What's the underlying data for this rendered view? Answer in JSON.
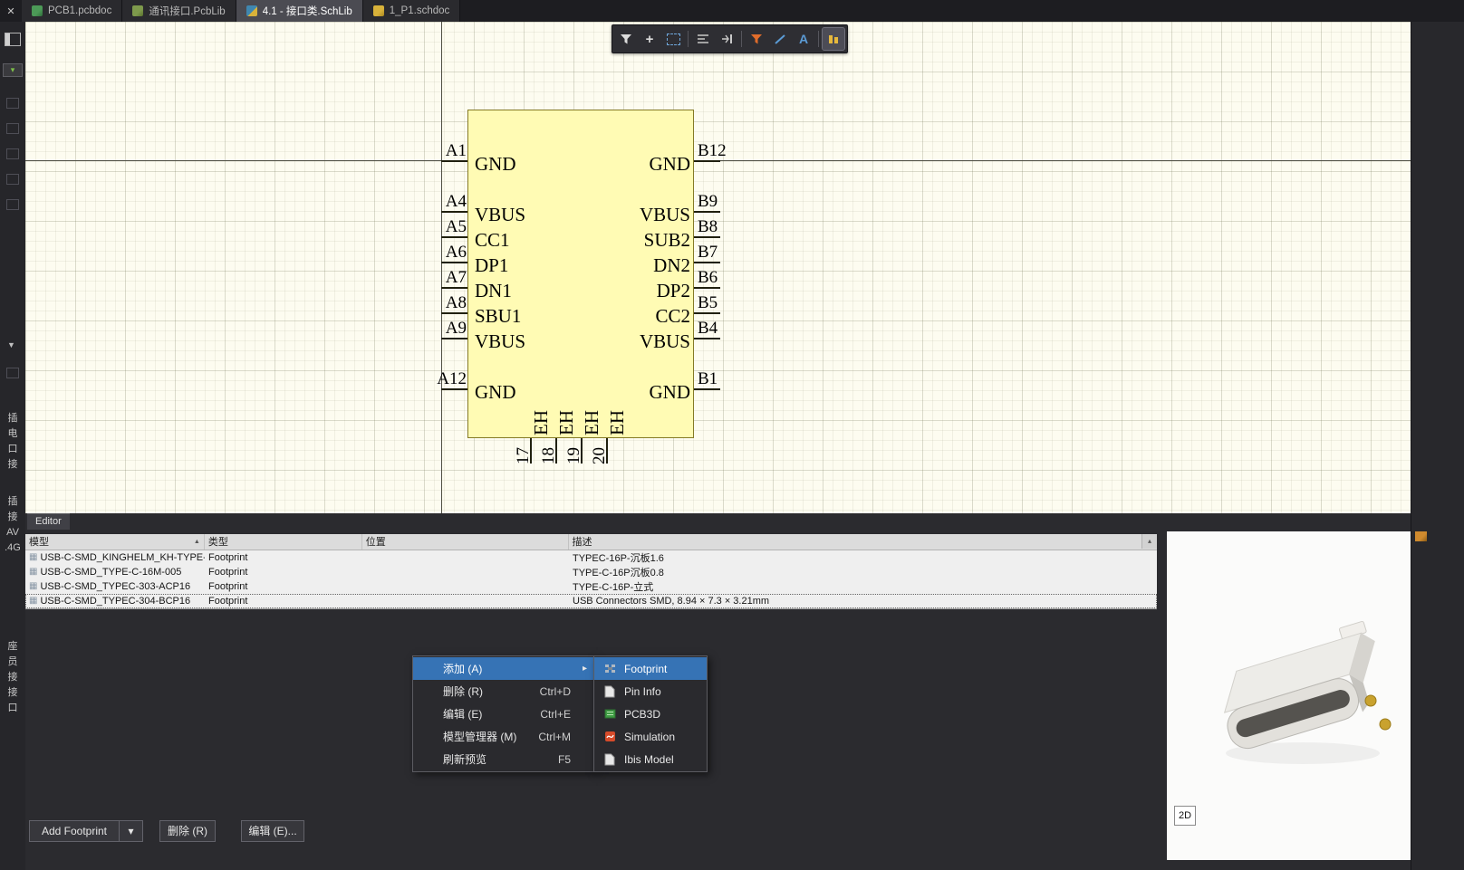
{
  "tabbar": {
    "close_glyph": "✕",
    "tabs": [
      {
        "label": "PCB1.pcbdoc"
      },
      {
        "label": "通讯接口.PcbLib"
      },
      {
        "label": "4.1 - 接口类.SchLib"
      },
      {
        "label": "1_P1.schdoc"
      }
    ]
  },
  "sidebar": {
    "group1": "插\n电\n口\n接",
    "group2": "插\n接\nAV\n.4G",
    "group3": "座\n员\n接\n接\n口"
  },
  "schematic": {
    "left_pins": [
      {
        "designator": "A1",
        "name": "GND"
      },
      {
        "designator": "A4",
        "name": "VBUS"
      },
      {
        "designator": "A5",
        "name": "CC1"
      },
      {
        "designator": "A6",
        "name": "DP1"
      },
      {
        "designator": "A7",
        "name": "DN1"
      },
      {
        "designator": "A8",
        "name": "SBU1"
      },
      {
        "designator": "A9",
        "name": "VBUS"
      },
      {
        "designator": "A12",
        "name": "GND"
      }
    ],
    "right_pins": [
      {
        "designator": "B12",
        "name": "GND"
      },
      {
        "designator": "B9",
        "name": "VBUS"
      },
      {
        "designator": "B8",
        "name": "SUB2"
      },
      {
        "designator": "B7",
        "name": "DN2"
      },
      {
        "designator": "B6",
        "name": "DP2"
      },
      {
        "designator": "B5",
        "name": "CC2"
      },
      {
        "designator": "B4",
        "name": "VBUS"
      },
      {
        "designator": "B1",
        "name": "GND"
      }
    ],
    "bottom_pins": [
      {
        "designator": "17",
        "name": "EH"
      },
      {
        "designator": "18",
        "name": "EH"
      },
      {
        "designator": "19",
        "name": "EH"
      },
      {
        "designator": "20",
        "name": "EH"
      }
    ]
  },
  "editor": {
    "tab_label": "Editor",
    "columns": {
      "model": "模型",
      "type": "类型",
      "location": "位置",
      "description": "描述"
    },
    "rows": [
      {
        "model": "USB-C-SMD_KINGHELM_KH-TYPE-C-\\",
        "type": "Footprint",
        "location": "",
        "description": "TYPEC-16P-沉板1.6"
      },
      {
        "model": "USB-C-SMD_TYPE-C-16M-005",
        "type": "Footprint",
        "location": "",
        "description": "TYPE-C-16P沉板0.8"
      },
      {
        "model": "USB-C-SMD_TYPEC-303-ACP16",
        "type": "Footprint",
        "location": "",
        "description": "TYPE-C-16P-立式"
      },
      {
        "model": "USB-C-SMD_TYPEC-304-BCP16",
        "type": "Footprint",
        "location": "",
        "description": "USB Connectors SMD, 8.94 × 7.3 × 3.21mm"
      }
    ],
    "buttons": {
      "add": "Add Footprint",
      "dropdown_glyph": "▾",
      "delete": "删除 (R)",
      "edit": "编辑 (E)..."
    }
  },
  "context_menu": {
    "items": [
      {
        "label": "添加 (A)",
        "shortcut": ""
      },
      {
        "label": "删除 (R)",
        "shortcut": "Ctrl+D"
      },
      {
        "label": "编辑 (E)",
        "shortcut": "Ctrl+E"
      },
      {
        "label": "模型管理器 (M)",
        "shortcut": "Ctrl+M"
      },
      {
        "label": "刷新预览",
        "shortcut": "F5"
      }
    ],
    "submenu_arrow_glyph": "▸",
    "submenu": [
      {
        "label": "Footprint"
      },
      {
        "label": "Pin Info"
      },
      {
        "label": "PCB3D"
      },
      {
        "label": "Simulation"
      },
      {
        "label": "Ibis Model"
      }
    ]
  },
  "preview": {
    "view_button": "2D"
  },
  "icons": {
    "sort_asc": "▲",
    "scroll_up": "▴",
    "row_footprint": "▦",
    "collapse_arrow": "▼",
    "combo_arrow": "▾"
  },
  "colors": {
    "highlight": "#3673b5",
    "symbol_fill": "#fffbb4",
    "symbol_border": "#857a25",
    "canvas_bg": "#fdfcf0"
  }
}
